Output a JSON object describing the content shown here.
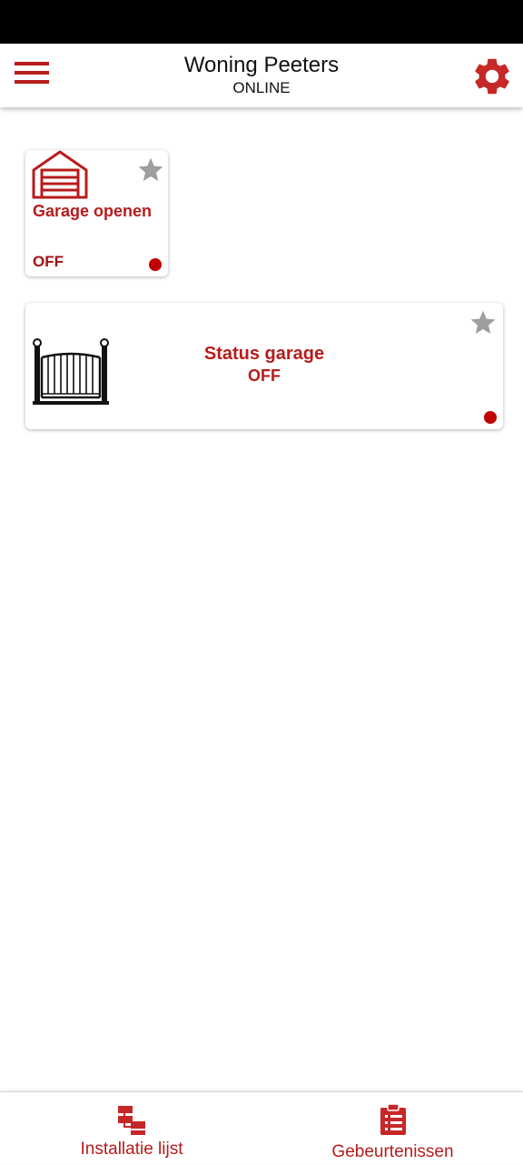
{
  "header": {
    "title": "Woning Peeters",
    "subtitle": "ONLINE",
    "menu_icon": "hamburger-menu-icon",
    "settings_icon": "gear-icon"
  },
  "devices": [
    {
      "label": "Garage openen",
      "state": "OFF",
      "icon": "garage-door-icon",
      "favorite_icon": "star-icon",
      "status_color": "#c00000"
    },
    {
      "label": "Status garage",
      "state": "OFF",
      "icon": "gate-icon",
      "favorite_icon": "star-icon",
      "status_color": "#c00000"
    }
  ],
  "bottom_nav": {
    "items": [
      {
        "label": "Installatie lijst",
        "icon": "installation-list-icon"
      },
      {
        "label": "Gebeurtenissen",
        "icon": "clipboard-list-icon"
      }
    ]
  },
  "colors": {
    "accent": "#b71c1c",
    "star_inactive": "#9e9e9e",
    "status_off": "#c00000"
  }
}
